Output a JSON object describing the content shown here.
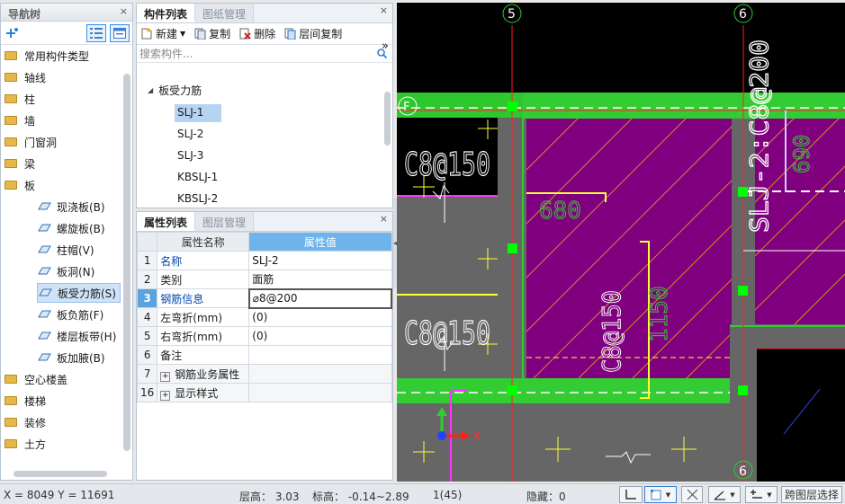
{
  "nav": {
    "title": "导航树",
    "close": "×",
    "items": [
      {
        "label": "常用构件类型",
        "type": "folder"
      },
      {
        "label": "轴线",
        "type": "folder"
      },
      {
        "label": "柱",
        "type": "folder"
      },
      {
        "label": "墙",
        "type": "folder"
      },
      {
        "label": "门窗洞",
        "type": "folder"
      },
      {
        "label": "梁",
        "type": "folder"
      },
      {
        "label": "板",
        "type": "folder-open"
      },
      {
        "label": "现浇板(B)",
        "type": "sub",
        "icon": "slab-icon"
      },
      {
        "label": "螺旋板(B)",
        "type": "sub",
        "icon": "spiral-slab-icon"
      },
      {
        "label": "柱帽(V)",
        "type": "sub",
        "icon": "column-cap-icon"
      },
      {
        "label": "板洞(N)",
        "type": "sub",
        "icon": "slab-hole-icon"
      },
      {
        "label": "板受力筋(S)",
        "type": "sub",
        "icon": "slab-rebar-icon",
        "selected": true
      },
      {
        "label": "板负筋(F)",
        "type": "sub",
        "icon": "negative-rebar-icon"
      },
      {
        "label": "楼层板带(H)",
        "type": "sub",
        "icon": "slab-strip-icon"
      },
      {
        "label": "板加腋(B)",
        "type": "sub",
        "icon": "slab-haunch-icon"
      },
      {
        "label": "空心楼盖",
        "type": "folder"
      },
      {
        "label": "楼梯",
        "type": "folder"
      },
      {
        "label": "装修",
        "type": "folder"
      },
      {
        "label": "土方",
        "type": "folder"
      }
    ]
  },
  "components": {
    "tabs": [
      "构件列表",
      "图纸管理"
    ],
    "close": "×",
    "toolbar": {
      "new": "新建",
      "copy": "复制",
      "delete": "删除",
      "floor_copy": "层间复制",
      "more": "»"
    },
    "search_placeholder": "搜索构件...",
    "group": "板受力筋",
    "items": [
      "SLJ-1",
      "SLJ-2",
      "SLJ-3",
      "KBSLJ-1",
      "KBSLJ-2"
    ],
    "selected": "SLJ-1"
  },
  "properties": {
    "tabs": [
      "属性列表",
      "图层管理"
    ],
    "close": "×",
    "headers": {
      "name": "属性名称",
      "value": "属性值"
    },
    "rows": [
      {
        "num": "1",
        "name": "名称",
        "value": "SLJ-2",
        "blue": true
      },
      {
        "num": "2",
        "name": "类别",
        "value": "面筋"
      },
      {
        "num": "3",
        "name": "钢筋信息",
        "value": "⌀8@200",
        "blue": true,
        "current": true
      },
      {
        "num": "4",
        "name": "左弯折(mm)",
        "value": "(0)"
      },
      {
        "num": "5",
        "name": "右弯折(mm)",
        "value": "(0)"
      },
      {
        "num": "6",
        "name": "备注",
        "value": ""
      },
      {
        "num": "7",
        "name": "钢筋业务属性",
        "value": "",
        "expand": "+"
      },
      {
        "num": "16",
        "name": "显示样式",
        "value": "",
        "expand": "+"
      }
    ]
  },
  "canvas": {
    "axis_labels": [
      "5",
      "6",
      "F",
      "6"
    ],
    "texts": {
      "c8a": "C8@150",
      "c8b": "C8@150",
      "c8v": "C8@150",
      "slj": "SLJ-2:C8@200",
      "n680": "680",
      "n690": "690",
      "n1150": "1150",
      "xaxis": "X"
    },
    "colors": {
      "background": "#000000",
      "slab": "#800080",
      "beam": "#33cc33",
      "gray": "#666666",
      "red_axis": "#ff2020",
      "yellow": "#ffff33",
      "white": "#ffffff",
      "magenta": "#ff33ff"
    }
  },
  "status": {
    "coords": "X = 8049 Y = 11691",
    "floor_height": "层高： 3.03",
    "elevation": "标高： -0.14~2.89",
    "count": "1(45)",
    "hidden": "隐藏：0",
    "cross_layer": "跨图层选择"
  }
}
